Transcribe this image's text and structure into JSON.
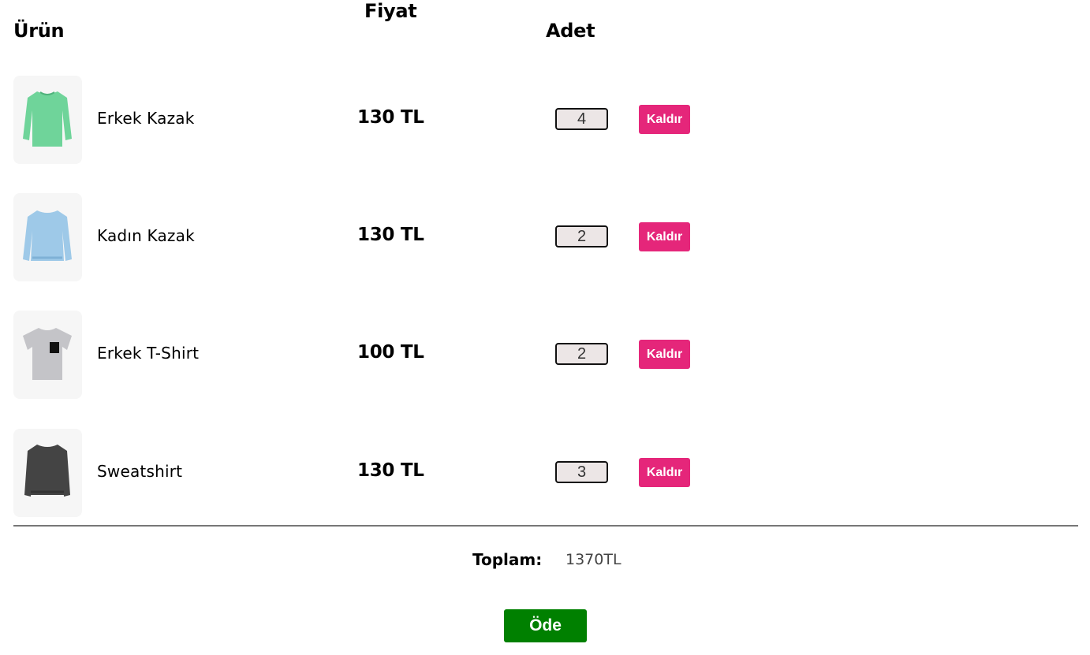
{
  "header": {
    "product_label": "Ürün",
    "price_label": "Fiyat",
    "quantity_label": "Adet"
  },
  "cart": {
    "items": [
      {
        "name": "Erkek Kazak",
        "price": "130 TL",
        "quantity": "4",
        "remove_label": "Kaldır",
        "image_icon": "green-sweater-icon",
        "image_color": "#6fd49a"
      },
      {
        "name": "Kadın Kazak",
        "price": "130 TL",
        "quantity": "2",
        "remove_label": "Kaldır",
        "image_icon": "blue-sweater-icon",
        "image_color": "#9ec9e8"
      },
      {
        "name": "Erkek T-Shirt",
        "price": "100 TL",
        "quantity": "2",
        "remove_label": "Kaldır",
        "image_icon": "grey-tshirt-icon",
        "image_color": "#c4c4c8"
      },
      {
        "name": "Sweatshirt",
        "price": "130 TL",
        "quantity": "3",
        "remove_label": "Kaldır",
        "image_icon": "dark-sweatshirt-icon",
        "image_color": "#444444"
      }
    ]
  },
  "summary": {
    "total_label": "Toplam:",
    "total_value": "1370TL",
    "pay_label": "Öde"
  },
  "colors": {
    "remove_button": "#e5267a",
    "pay_button": "#008000",
    "quantity_bg": "#ece6e6"
  }
}
